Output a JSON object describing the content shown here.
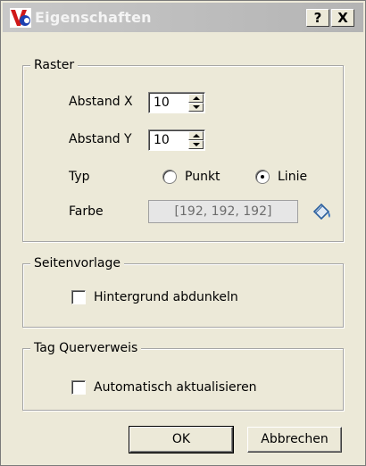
{
  "window": {
    "title": "Eigenschaften",
    "help_label": "?",
    "close_label": "X"
  },
  "raster": {
    "legend": "Raster",
    "abstand_x": {
      "label": "Abstand X",
      "value": "10"
    },
    "abstand_y": {
      "label": "Abstand Y",
      "value": "10"
    },
    "typ": {
      "label": "Typ",
      "options": [
        "Punkt",
        "Linie"
      ],
      "selected": "Linie"
    },
    "farbe": {
      "label": "Farbe",
      "value": "[192, 192, 192]"
    }
  },
  "seitenvorlage": {
    "legend": "Seitenvorlage",
    "checkbox_label": "Hintergrund abdunkeln",
    "checked": false
  },
  "tag_querverweis": {
    "legend": "Tag Querverweis",
    "checkbox_label": "Automatisch aktualisieren",
    "checked": false
  },
  "buttons": {
    "ok": "OK",
    "cancel": "Abbrechen"
  }
}
